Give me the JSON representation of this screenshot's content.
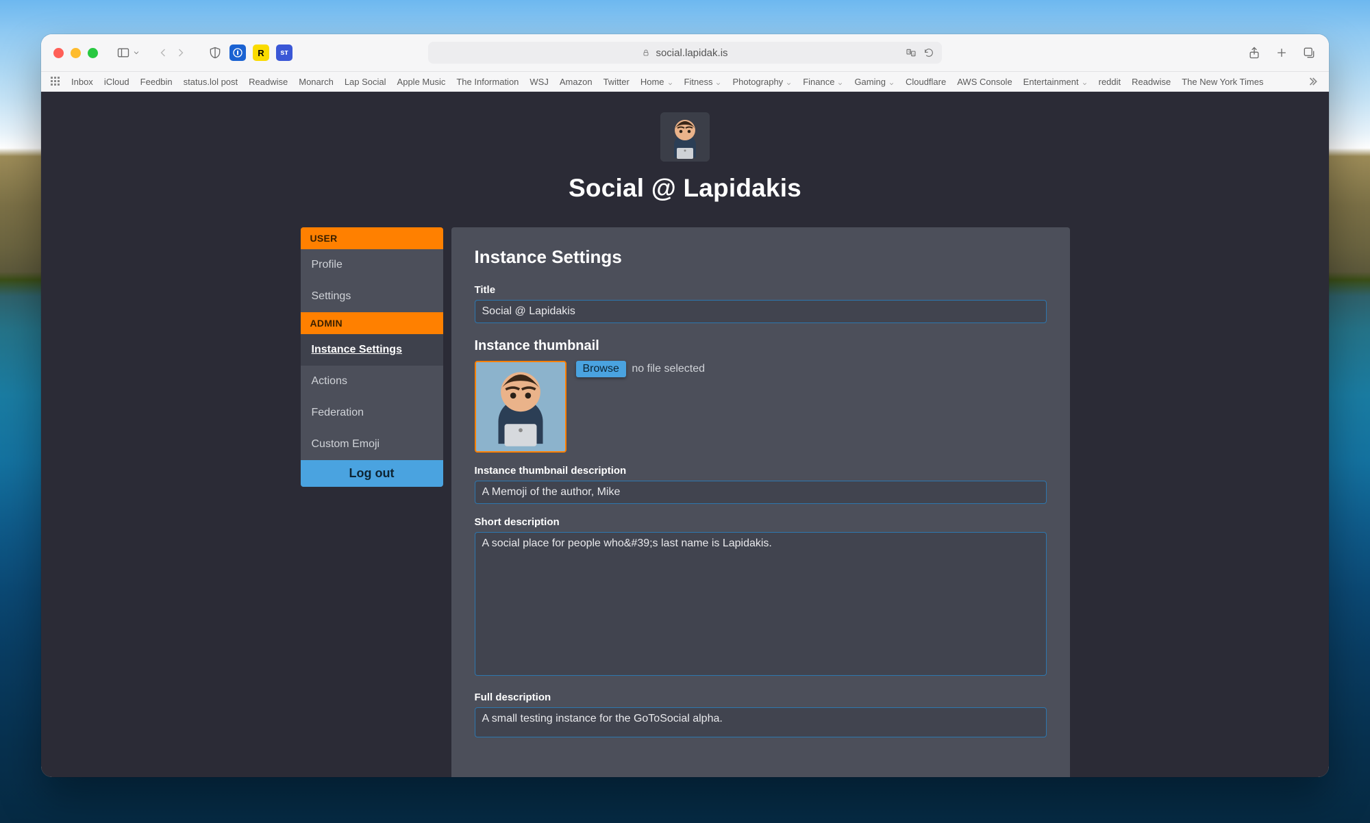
{
  "browser": {
    "url_display": "social.lapidak.is",
    "bookmarks": [
      "Inbox",
      "iCloud",
      "Feedbin",
      "status.lol post",
      "Readwise",
      "Monarch",
      "Lap Social",
      "Apple Music",
      "The Information",
      "WSJ",
      "Amazon",
      "Twitter",
      "Home",
      "Fitness",
      "Photography",
      "Finance",
      "Gaming",
      "Cloudflare",
      "AWS Console",
      "Entertainment",
      "reddit",
      "Readwise",
      "The New York Times"
    ],
    "bookmark_has_dropdown": {
      "Home": true,
      "Fitness": true,
      "Photography": true,
      "Finance": true,
      "Gaming": true,
      "Entertainment": true
    }
  },
  "page": {
    "title": "Social @ Lapidakis"
  },
  "sidebar": {
    "section_user": "USER",
    "section_admin": "ADMIN",
    "items_user": [
      {
        "label": "Profile"
      },
      {
        "label": "Settings"
      }
    ],
    "items_admin": [
      {
        "label": "Instance Settings",
        "active": true
      },
      {
        "label": "Actions"
      },
      {
        "label": "Federation"
      },
      {
        "label": "Custom Emoji"
      }
    ],
    "logout": "Log out"
  },
  "settings": {
    "heading": "Instance Settings",
    "title_label": "Title",
    "title_value": "Social @ Lapidakis",
    "thumb_heading": "Instance thumbnail",
    "browse_label": "Browse",
    "no_file": "no file selected",
    "thumb_desc_label": "Instance thumbnail description",
    "thumb_desc_value": "A Memoji of the author, Mike",
    "short_label": "Short description",
    "short_value": "A social place for people who&#39;s last name is Lapidakis.",
    "full_label": "Full description",
    "full_value": "A small testing instance for the GoToSocial alpha."
  },
  "colors": {
    "accent": "#ff8000",
    "link": "#4aa3e0"
  }
}
